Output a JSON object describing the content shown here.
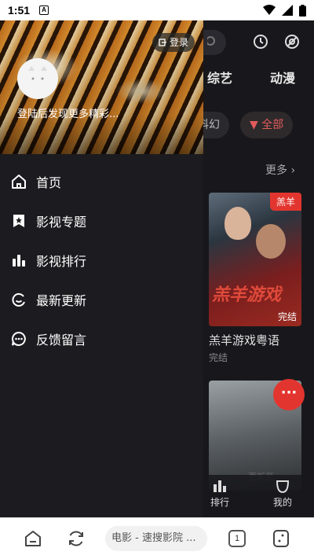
{
  "status_bar": {
    "time": "1:51",
    "notification_glyph": "A"
  },
  "drawer": {
    "login_label": "登录",
    "login_hint": "登陆后发现更多精彩...",
    "menu": [
      {
        "label": "首页",
        "icon": "home-icon"
      },
      {
        "label": "影视专题",
        "icon": "star-bookmark-icon"
      },
      {
        "label": "影视排行",
        "icon": "bar-chart-icon"
      },
      {
        "label": "最新更新",
        "icon": "refresh-face-icon"
      },
      {
        "label": "反馈留言",
        "icon": "chat-bubble-icon"
      }
    ]
  },
  "background": {
    "tabs": [
      "综艺",
      "动漫"
    ],
    "chips": [
      "科幻",
      "全部"
    ],
    "more_label": "更多",
    "card1": {
      "tag": "羔羊",
      "art_text": "羔羊游戏",
      "status": "完结",
      "title": "羔羊游戏粤语",
      "subtitle": "完结"
    },
    "card2": {
      "art_text": "更新至"
    },
    "fab_label": "···",
    "nav": [
      {
        "label": "排行"
      },
      {
        "label": "我的"
      }
    ]
  },
  "browser_bar": {
    "url_text": "电影 - 速搜影院 ...",
    "tab_count": "1"
  },
  "colors": {
    "accent": "#e3352f",
    "drawer_bg": "#1c1c20",
    "text": "#ffffff"
  }
}
